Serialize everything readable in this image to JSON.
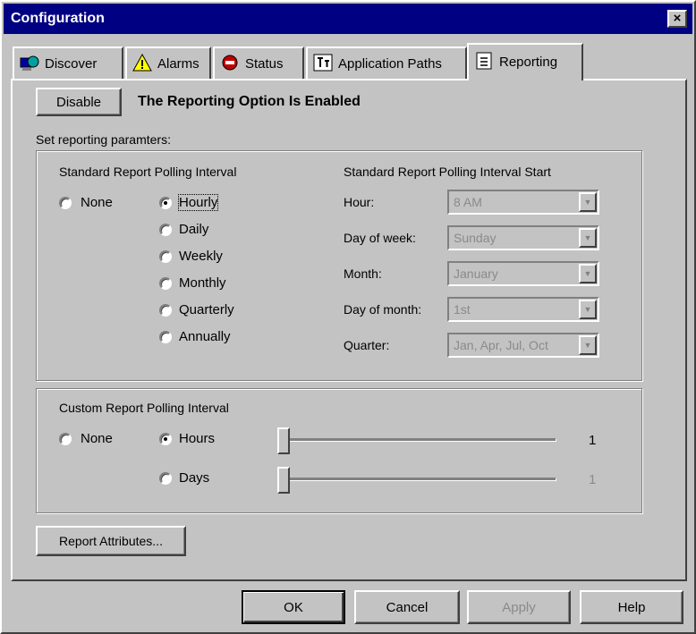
{
  "window": {
    "title": "Configuration",
    "close_glyph": "×"
  },
  "tabs": [
    {
      "label": "Discover",
      "icon": "discover-icon"
    },
    {
      "label": "Alarms",
      "icon": "alarms-icon"
    },
    {
      "label": "Status",
      "icon": "status-icon"
    },
    {
      "label": "Application Paths",
      "icon": "application-paths-icon"
    },
    {
      "label": "Reporting",
      "icon": "reporting-icon",
      "active": true
    }
  ],
  "reporting": {
    "disable_label": "Disable",
    "status_text": "The Reporting Option Is Enabled",
    "set_params_label": "Set reporting paramters:"
  },
  "standard": {
    "title": "Standard Report Polling Interval",
    "none_label": "None",
    "options": [
      "Hourly",
      "Daily",
      "Weekly",
      "Monthly",
      "Quarterly",
      "Annually"
    ],
    "selected": "Hourly",
    "start_title": "Standard Report Polling Interval Start",
    "fields": [
      {
        "label": "Hour:",
        "value": "8 AM"
      },
      {
        "label": "Day of week:",
        "value": "Sunday"
      },
      {
        "label": "Month:",
        "value": "January"
      },
      {
        "label": "Day of month:",
        "value": "1st"
      },
      {
        "label": "Quarter:",
        "value": "Jan, Apr, Jul, Oct"
      }
    ]
  },
  "custom": {
    "title": "Custom Report Polling Interval",
    "none_label": "None",
    "hours_label": "Hours",
    "days_label": "Days",
    "selected": "Hours",
    "hours_value": "1",
    "days_value": "1"
  },
  "report_attributes_label": "Report Attributes...",
  "footer": {
    "ok_label": "OK",
    "cancel_label": "Cancel",
    "apply_label": "Apply",
    "help_label": "Help"
  }
}
